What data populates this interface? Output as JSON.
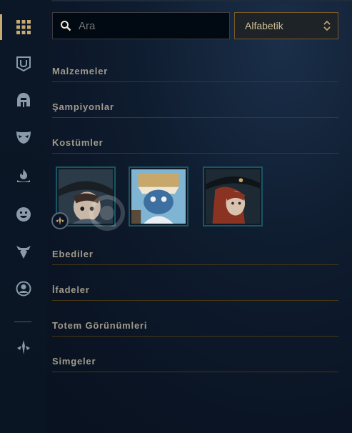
{
  "search": {
    "placeholder": "Ara",
    "value": ""
  },
  "sort": {
    "selected": "Alfabetik"
  },
  "sidebar": {
    "items": [
      {
        "name": "grid-icon",
        "active": true
      },
      {
        "name": "ward-icon"
      },
      {
        "name": "helmet-icon"
      },
      {
        "name": "mask-icon"
      },
      {
        "name": "flame-icon"
      },
      {
        "name": "emote-icon"
      },
      {
        "name": "totem-icon"
      },
      {
        "name": "profile-icon"
      },
      {
        "name": "crest-icon"
      }
    ]
  },
  "sections": {
    "materials": "Malzemeler",
    "champions": "Şampiyonlar",
    "skins": "Kostümler",
    "eternals": "Ebediler",
    "emotes": "İfadeler",
    "totem_skins": "Totem Görünümleri",
    "icons": "Simgeler"
  },
  "colors": {
    "gold": "#c8aa6e",
    "gold_dark": "#463714",
    "text_muted": "#a09b8c",
    "teal_border": "#1a5564"
  }
}
